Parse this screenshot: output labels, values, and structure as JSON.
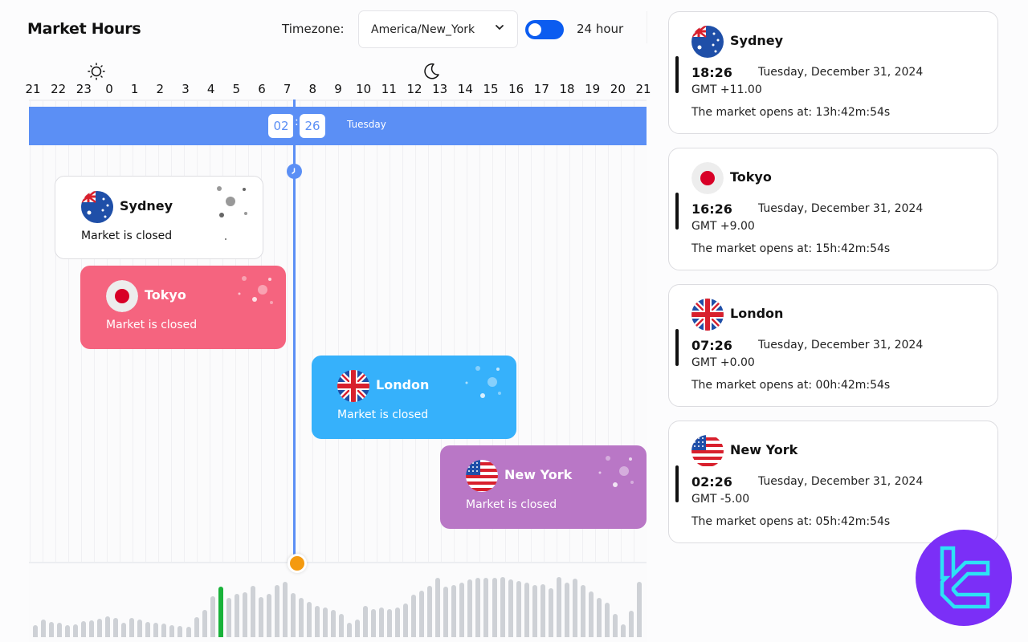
{
  "header": {
    "title": "Market Hours",
    "timezone_label": "Timezone:",
    "timezone_value": "America/New_York",
    "format_toggle_label": "24 hour"
  },
  "timeline": {
    "hour_labels": [
      "21",
      "22",
      "23",
      "0",
      "1",
      "2",
      "3",
      "4",
      "5",
      "6",
      "7",
      "8",
      "9",
      "10",
      "11",
      "12",
      "13",
      "14",
      "15",
      "16",
      "17",
      "18",
      "19",
      "20",
      "21"
    ],
    "current_hour": "02",
    "current_minute": "26",
    "colon": ":",
    "current_day": "Tuesday",
    "day_icon": "sun-icon",
    "night_icon": "moon-icon",
    "now_marker_icon": "clock-icon"
  },
  "markets": [
    {
      "id": "sydney",
      "name": "Sydney",
      "status": "Market is closed",
      "color": "#ffffff",
      "flag": "australia-flag-icon"
    },
    {
      "id": "tokyo",
      "name": "Tokyo",
      "status": "Market is closed",
      "color": "#f5647f",
      "flag": "japan-flag-icon"
    },
    {
      "id": "london",
      "name": "London",
      "status": "Market is closed",
      "color": "#36b1fb",
      "flag": "uk-flag-icon"
    },
    {
      "id": "ny",
      "name": "New York",
      "status": "Market is closed",
      "color": "#b977c6",
      "flag": "usa-flag-icon"
    }
  ],
  "cards": [
    {
      "name": "Sydney",
      "time": "18:26",
      "date": "Tuesday, December 31, 2024",
      "gmt": "GMT +11.00",
      "opens": "The market opens at: 13h:42m:54s"
    },
    {
      "name": "Tokyo",
      "time": "16:26",
      "date": "Tuesday, December 31, 2024",
      "gmt": "GMT +9.00",
      "opens": "The market opens at: 15h:42m:54s"
    },
    {
      "name": "London",
      "time": "07:26",
      "date": "Tuesday, December 31, 2024",
      "gmt": "GMT +0.00",
      "opens": "The market opens at: 00h:42m:54s"
    },
    {
      "name": "New York",
      "time": "02:26",
      "date": "Tuesday, December 31, 2024",
      "gmt": "GMT -5.00",
      "opens": "The market opens at: 05h:42m:54s"
    }
  ],
  "volume": {
    "active_index": 23,
    "max": 80,
    "values": [
      15,
      22,
      19,
      18,
      15,
      16,
      20,
      21,
      23,
      26,
      24,
      18,
      24,
      22,
      19,
      18,
      17,
      15,
      14,
      13,
      25,
      34,
      51,
      63,
      49,
      54,
      56,
      64,
      50,
      54,
      65,
      69,
      55,
      49,
      44,
      39,
      37,
      34,
      29,
      18,
      22,
      39,
      35,
      37,
      35,
      37,
      42,
      53,
      58,
      64,
      74,
      63,
      65,
      68,
      72,
      74,
      74,
      74,
      75,
      72,
      70,
      68,
      65,
      66,
      61,
      75,
      68,
      73,
      65,
      57,
      49,
      43,
      29,
      16,
      33,
      69
    ],
    "accent_color": "#19b23a"
  },
  "colors": {
    "accent_blue": "#5b8ff5",
    "toggle_blue": "#0b5cf0",
    "slider_orange": "#f49a10",
    "logo_purple": "#7b2ff7",
    "logo_cyan": "#2de2f5"
  }
}
